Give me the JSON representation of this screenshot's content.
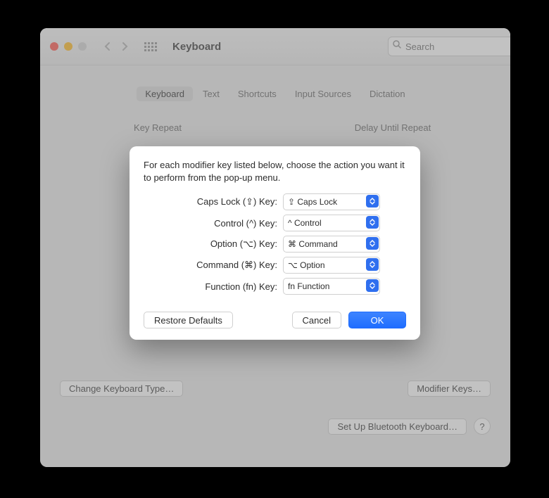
{
  "window": {
    "title": "Keyboard",
    "search_placeholder": "Search"
  },
  "tabs": {
    "items": [
      {
        "label": "Keyboard",
        "active": true
      },
      {
        "label": "Text",
        "active": false
      },
      {
        "label": "Shortcuts",
        "active": false
      },
      {
        "label": "Input Sources",
        "active": false
      },
      {
        "label": "Dictation",
        "active": false
      }
    ]
  },
  "sections": {
    "key_repeat": "Key Repeat",
    "delay_until": "Delay Until Repeat"
  },
  "bottom": {
    "change_type": "Change Keyboard Type…",
    "modifier_keys": "Modifier Keys…",
    "bluetooth": "Set Up Bluetooth Keyboard…",
    "help": "?"
  },
  "sheet": {
    "description": "For each modifier key listed below, choose the action you want it to perform from the pop-up menu.",
    "rows": [
      {
        "label": "Caps Lock (⇪) Key:",
        "value": "⇪ Caps Lock"
      },
      {
        "label": "Control (^) Key:",
        "value": "^ Control"
      },
      {
        "label": "Option (⌥) Key:",
        "value": "⌘ Command"
      },
      {
        "label": "Command (⌘) Key:",
        "value": "⌥ Option"
      },
      {
        "label": "Function (fn) Key:",
        "value": "fn Function"
      }
    ],
    "restore_defaults": "Restore Defaults",
    "cancel": "Cancel",
    "ok": "OK"
  }
}
